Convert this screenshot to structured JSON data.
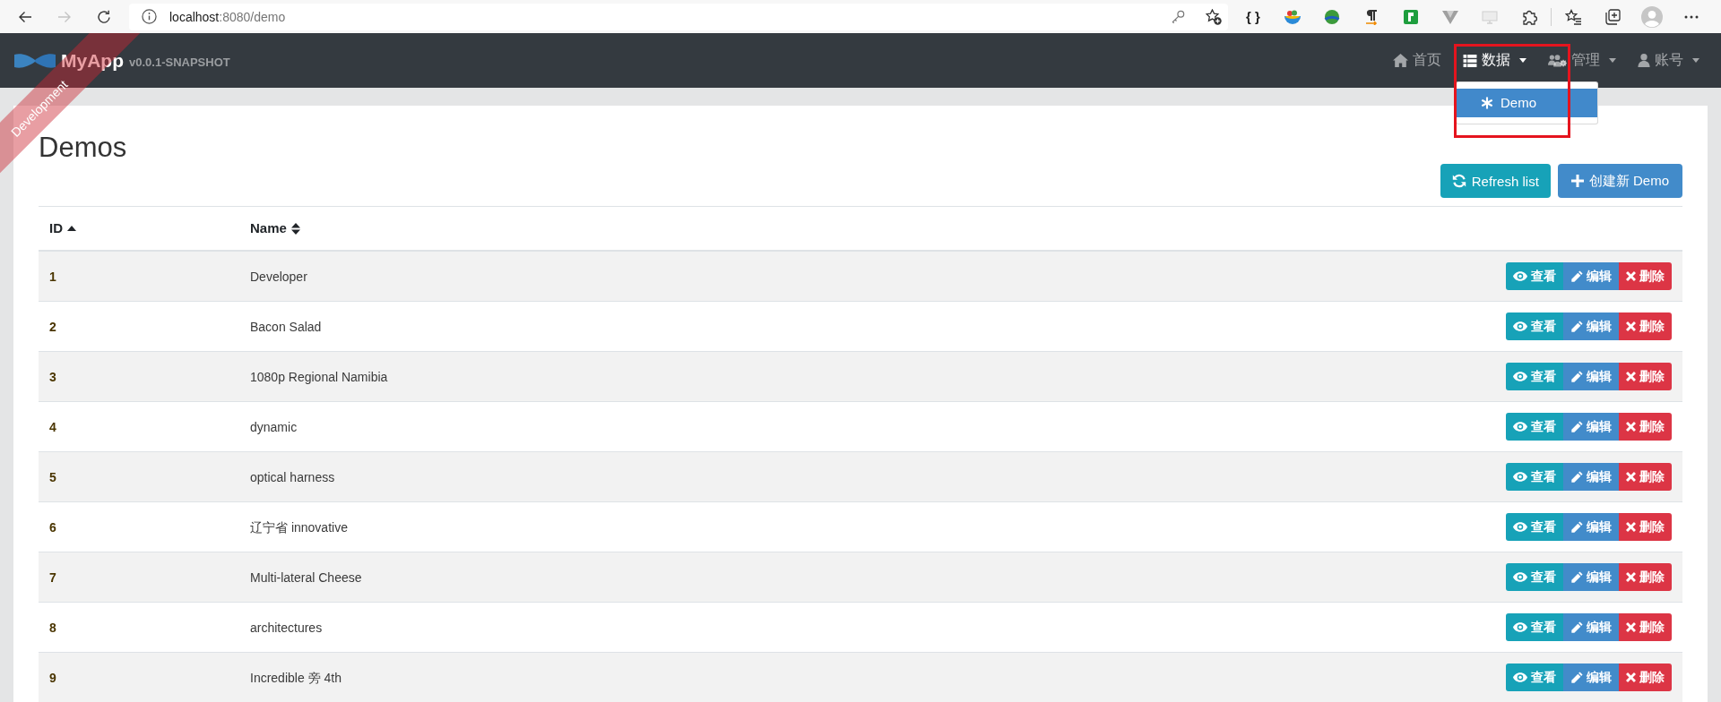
{
  "browser": {
    "nav_buttons": [
      {
        "kind": "back",
        "disabled": false
      },
      {
        "kind": "forward",
        "disabled": true
      },
      {
        "kind": "reload",
        "disabled": false
      }
    ],
    "address": {
      "host": "localhost",
      "path": ":8080/demo"
    },
    "extension_label": "{ }"
  },
  "navbar": {
    "brand": "MyApp",
    "version": "v0.0.1-SNAPSHOT",
    "ribbon": "Development",
    "items": [
      {
        "label": "首页",
        "dropdown": false,
        "selected": false,
        "expanded": false
      },
      {
        "label": "数据",
        "dropdown": true,
        "selected": true,
        "expanded": true,
        "menu": [
          {
            "label": "Demo",
            "selected": true
          }
        ]
      },
      {
        "label": "管理",
        "dropdown": true,
        "selected": false,
        "expanded": false
      },
      {
        "label": "账号",
        "dropdown": true,
        "selected": false,
        "expanded": false
      }
    ]
  },
  "page": {
    "title": "Demos",
    "buttons": [
      {
        "kind": "refresh",
        "label": "Refresh list"
      },
      {
        "kind": "create",
        "label": "创建新 Demo"
      }
    ]
  },
  "table": {
    "columns": [
      {
        "label": "ID",
        "sorted": true
      },
      {
        "label": "Name",
        "sorted": false
      }
    ],
    "rows": [
      {
        "id": "1",
        "name": "Developer",
        "actions": [
          {
            "kind": "view",
            "label": "查看"
          },
          {
            "kind": "edit",
            "label": "编辑"
          },
          {
            "kind": "delete",
            "label": "删除"
          }
        ]
      },
      {
        "id": "2",
        "name": "Bacon Salad",
        "actions": [
          {
            "kind": "view",
            "label": "查看"
          },
          {
            "kind": "edit",
            "label": "编辑"
          },
          {
            "kind": "delete",
            "label": "删除"
          }
        ]
      },
      {
        "id": "3",
        "name": "1080p Regional Namibia",
        "actions": [
          {
            "kind": "view",
            "label": "查看"
          },
          {
            "kind": "edit",
            "label": "编辑"
          },
          {
            "kind": "delete",
            "label": "删除"
          }
        ]
      },
      {
        "id": "4",
        "name": "dynamic",
        "actions": [
          {
            "kind": "view",
            "label": "查看"
          },
          {
            "kind": "edit",
            "label": "编辑"
          },
          {
            "kind": "delete",
            "label": "删除"
          }
        ]
      },
      {
        "id": "5",
        "name": "optical harness",
        "actions": [
          {
            "kind": "view",
            "label": "查看"
          },
          {
            "kind": "edit",
            "label": "编辑"
          },
          {
            "kind": "delete",
            "label": "删除"
          }
        ]
      },
      {
        "id": "6",
        "name": "辽宁省 innovative",
        "actions": [
          {
            "kind": "view",
            "label": "查看"
          },
          {
            "kind": "edit",
            "label": "编辑"
          },
          {
            "kind": "delete",
            "label": "删除"
          }
        ]
      },
      {
        "id": "7",
        "name": "Multi-lateral Cheese",
        "actions": [
          {
            "kind": "view",
            "label": "查看"
          },
          {
            "kind": "edit",
            "label": "编辑"
          },
          {
            "kind": "delete",
            "label": "删除"
          }
        ]
      },
      {
        "id": "8",
        "name": "architectures",
        "actions": [
          {
            "kind": "view",
            "label": "查看"
          },
          {
            "kind": "edit",
            "label": "编辑"
          },
          {
            "kind": "delete",
            "label": "删除"
          }
        ]
      },
      {
        "id": "9",
        "name": "Incredible 旁 4th",
        "actions": [
          {
            "kind": "view",
            "label": "查看"
          },
          {
            "kind": "edit",
            "label": "编辑"
          },
          {
            "kind": "delete",
            "label": "删除"
          }
        ]
      }
    ]
  }
}
